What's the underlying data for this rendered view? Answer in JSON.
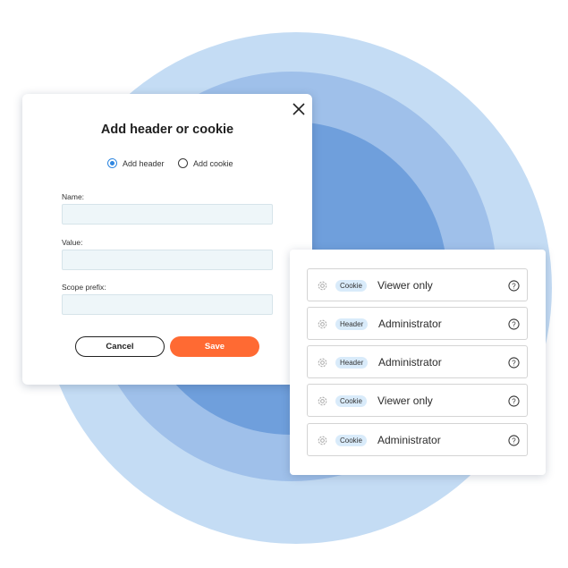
{
  "modal": {
    "title": "Add header or cookie",
    "radio_options": [
      {
        "label": "Add header",
        "checked": true
      },
      {
        "label": "Add cookie",
        "checked": false
      }
    ],
    "fields": [
      {
        "label": "Name:",
        "value": ""
      },
      {
        "label": "Value:",
        "value": ""
      },
      {
        "label": "Scope prefix:",
        "value": ""
      }
    ],
    "cancel_label": "Cancel",
    "save_label": "Save",
    "close_icon": "close-icon"
  },
  "list": {
    "rows": [
      {
        "type": "Cookie",
        "role": "Viewer only"
      },
      {
        "type": "Header",
        "role": "Administrator"
      },
      {
        "type": "Header",
        "role": "Administrator"
      },
      {
        "type": "Cookie",
        "role": "Viewer only"
      },
      {
        "type": "Cookie",
        "role": "Administrator"
      }
    ]
  },
  "colors": {
    "accent_blue": "#2e86e0",
    "save_orange": "#ff6a33",
    "badge_bg": "#d9ebfa",
    "circle_outer": "#c4dcf4",
    "circle_middle": "#9fc0ea",
    "circle_inner": "#6f9fdc"
  }
}
